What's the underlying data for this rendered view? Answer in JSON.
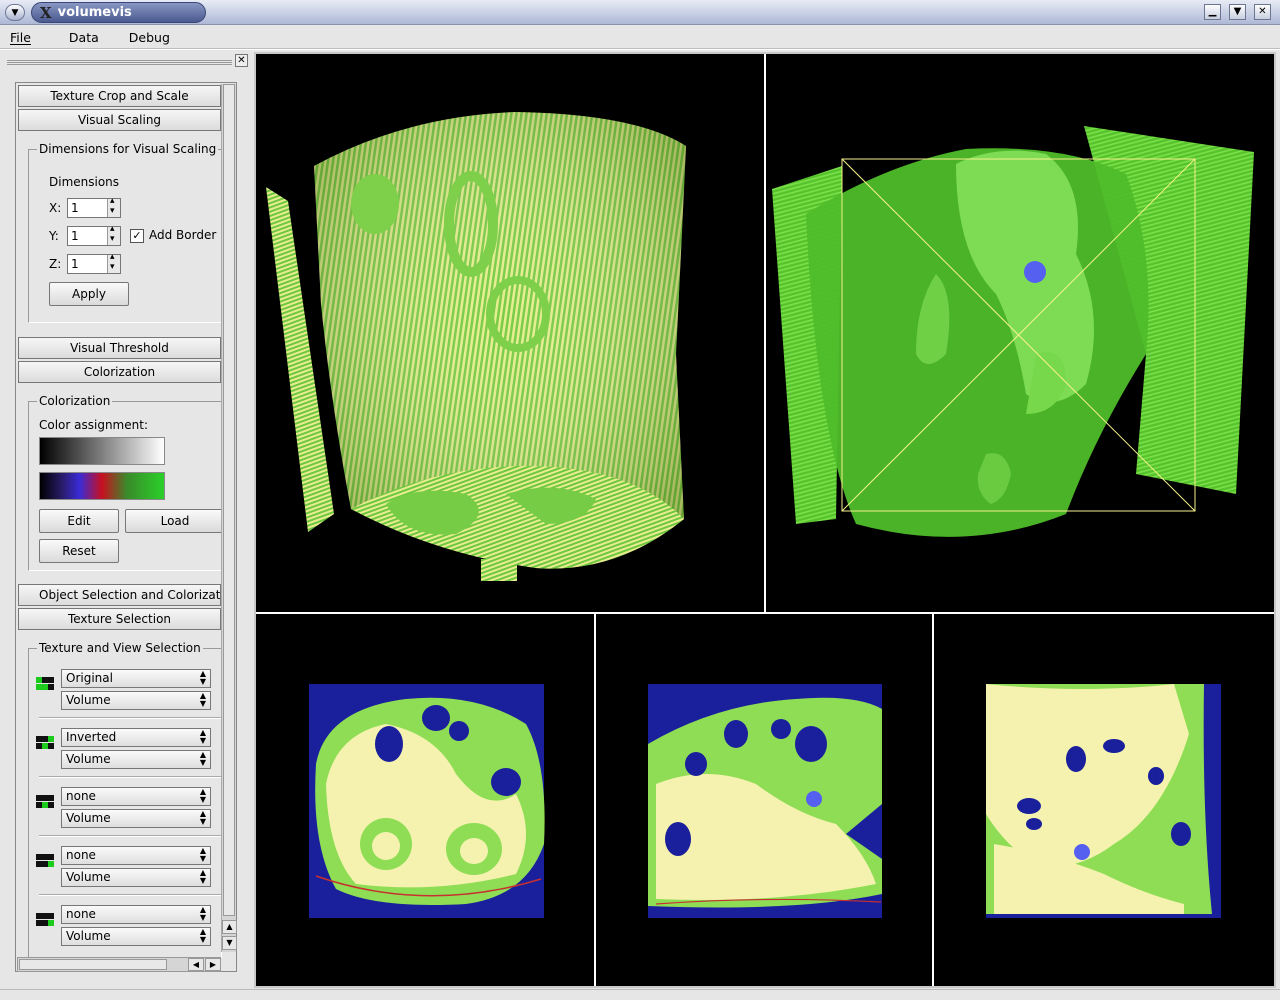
{
  "window": {
    "title": "volumevis"
  },
  "menu": [
    "File",
    "Data",
    "Debug"
  ],
  "panel": {
    "sections": {
      "texture_crop": "Texture Crop and Scale",
      "visual_scaling": "Visual Scaling",
      "visual_threshold": "Visual Threshold",
      "colorization": "Colorization",
      "object_selection": "Object Selection and Colorizatio",
      "texture_selection": "Texture Selection"
    },
    "scaling": {
      "group_title": "Dimensions for Visual Scaling",
      "dimensions_label": "Dimensions",
      "x_label": "X:",
      "x_value": "1",
      "y_label": "Y:",
      "y_value": "1",
      "z_label": "Z:",
      "z_value": "1",
      "add_border_label": "Add Border",
      "add_border_checked": true,
      "apply": "Apply"
    },
    "colorization": {
      "group_title": "Colorization",
      "assignment_label": "Color assignment:",
      "edit": "Edit",
      "load": "Load",
      "reset": "Reset"
    },
    "texture_view": {
      "group_title": "Texture and View Selection",
      "rows": [
        {
          "texture": "Original",
          "view": "Volume"
        },
        {
          "texture": "Inverted",
          "view": "Volume"
        },
        {
          "texture": "none",
          "view": "Volume"
        },
        {
          "texture": "none",
          "view": "Volume"
        },
        {
          "texture": "none",
          "view": "Volume"
        }
      ]
    }
  },
  "colors": {
    "volume_green": "#6fd63e",
    "slice_yellow": "#f2f0a8",
    "slice_blue": "#1a1f9c",
    "marker_blue": "#5560f0",
    "viewport_bg": "#000000"
  }
}
